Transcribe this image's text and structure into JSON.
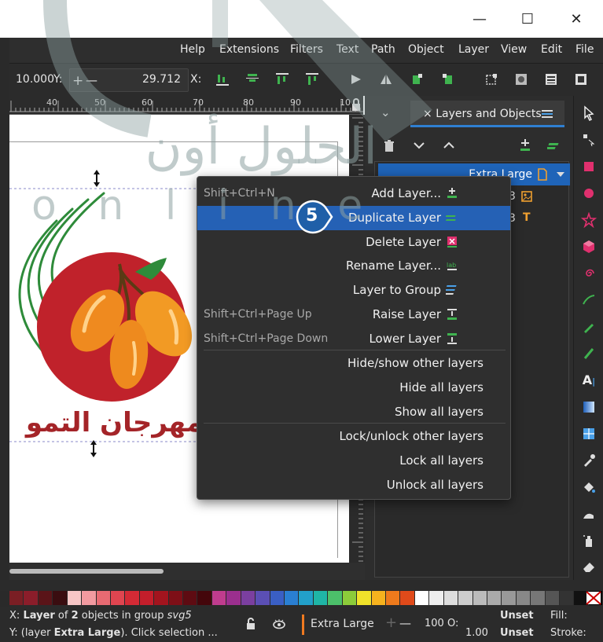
{
  "window": {
    "minimize_glyph": "—",
    "maximize_glyph": "☐",
    "close_glyph": "✕"
  },
  "menubar": {
    "items": [
      "Help",
      "Extensions",
      "Filters",
      "Text",
      "Path",
      "Object",
      "Layer",
      "View",
      "Edit",
      "File"
    ]
  },
  "tool_controls": {
    "width_value": "10.000",
    "y_label": "Y:",
    "plus": "+",
    "minus": "—",
    "y_value": "29.712",
    "x_label": "X:"
  },
  "ruler": {
    "numbers": [
      "40",
      "50",
      "60",
      "70",
      "80",
      "90",
      "10"
    ]
  },
  "layers_panel": {
    "tab_close": "×",
    "tab_label": "Layers and Objects",
    "collapse": "⌄",
    "row_label": "Extra Large",
    "row_suffix": "3",
    "row_suffix_2": "3"
  },
  "canvas": {
    "arabic_title": "مهرجان التمو"
  },
  "watermark": {
    "arabic": "الحلول أون",
    "latin": "o n l i n e"
  },
  "context_menu": {
    "items": [
      {
        "shortcut": "Shift+Ctrl+N",
        "label": "Add Layer...",
        "icon": "add-layer-icon"
      },
      {
        "shortcut": "",
        "label": "Duplicate Layer",
        "icon": "duplicate-layer-icon",
        "highlighted": true
      },
      {
        "shortcut": "",
        "label": "Delete Layer",
        "icon": "delete-layer-icon"
      },
      {
        "shortcut": "",
        "label": "Rename Layer...",
        "icon": "rename-layer-icon"
      },
      {
        "shortcut": "",
        "label": "Layer to Group",
        "icon": "layer-to-group-icon"
      },
      {
        "shortcut": "Shift+Ctrl+Page Up",
        "label": "Raise Layer",
        "icon": "raise-layer-icon"
      },
      {
        "shortcut": "Shift+Ctrl+Page Down",
        "label": "Lower Layer",
        "icon": "lower-layer-icon"
      },
      {
        "shortcut": "",
        "label": "Hide/show other layers",
        "icon": ""
      },
      {
        "shortcut": "",
        "label": "Hide all layers",
        "icon": ""
      },
      {
        "shortcut": "",
        "label": "Show all layers",
        "icon": ""
      },
      {
        "shortcut": "",
        "label": "Lock/unlock other layers",
        "icon": ""
      },
      {
        "shortcut": "",
        "label": "Lock all layers",
        "icon": ""
      },
      {
        "shortcut": "",
        "label": "Unlock all layers",
        "icon": ""
      }
    ]
  },
  "step_badge": "5",
  "palette": {
    "colors": [
      "#7a1e24",
      "#8b1d2a",
      "#5a1418",
      "#3a0d10",
      "#f7c6c6",
      "#f29aa0",
      "#e86a72",
      "#e04550",
      "#d42a35",
      "#c41e2b",
      "#a3141e",
      "#7e0f17",
      "#5e0b12",
      "#44060b",
      "#c03c8e",
      "#9b2f8e",
      "#7b3fa0",
      "#5b4fb5",
      "#3a5fc4",
      "#2a7fd2",
      "#22a0c9",
      "#1fb5a6",
      "#4cc06a",
      "#8ccc3a",
      "#f0e22a",
      "#f6b21e",
      "#ee7a1c",
      "#e04a1a",
      "#ffffff",
      "#eeeeee",
      "#dddddd",
      "#cccccc",
      "#bbbbbb",
      "#aaaaaa",
      "#999999",
      "#888888",
      "#777777",
      "#555555",
      "#333333",
      "#111111",
      "#000000"
    ]
  },
  "status": {
    "x_label": "X:",
    "line1_bold": "Layer",
    "line1_mid": " of ",
    "line1_count": "2",
    "line1_rest": " objects in group ",
    "line1_group": "svg5",
    "y_label": "Y:",
    "line2_start": "(layer ",
    "line2_bold": "Extra Large",
    "line2_rest": "). Click selection ...",
    "layer_name": "Extra Large",
    "plus": "+",
    "minus": "—",
    "opacity_value": "100",
    "o_label": "O:",
    "stroke_width": "1.00",
    "fill_value": "Unset",
    "stroke_value": "Unset",
    "fill_label": "Fill:",
    "stroke_label": "Stroke:"
  }
}
